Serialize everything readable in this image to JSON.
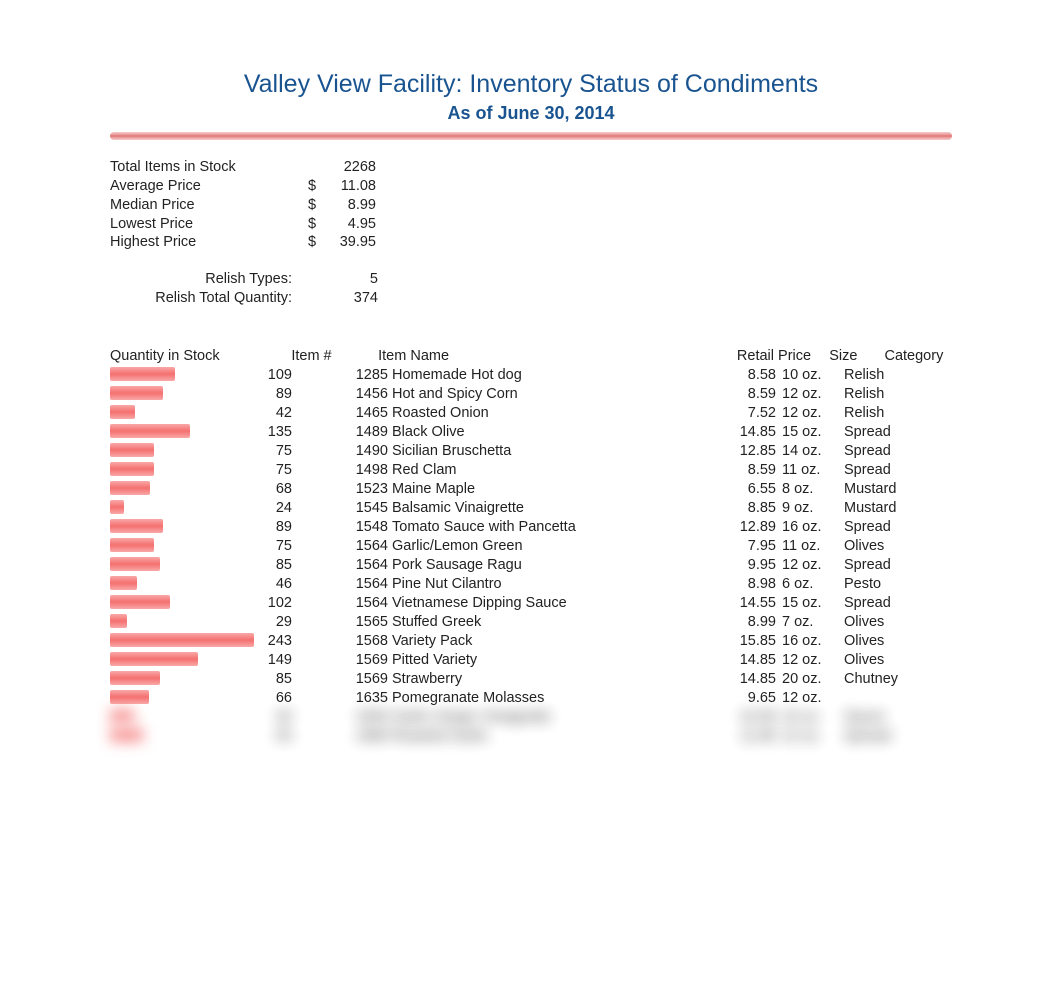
{
  "title": "Valley View Facility: Inventory Status of Condiments",
  "subtitle": "As of June 30, 2014",
  "stats": {
    "total_label": "Total Items in Stock",
    "total_value": "2268",
    "avg_label": "Average Price",
    "avg_dollar": "$",
    "avg_value": "11.08",
    "median_label": "Median Price",
    "median_dollar": "$",
    "median_value": "8.99",
    "lowest_label": "Lowest Price",
    "lowest_dollar": "$",
    "lowest_value": "4.95",
    "highest_label": "Highest Price",
    "highest_dollar": "$",
    "highest_value": "39.95"
  },
  "relish": {
    "types_label": "Relish Types:",
    "types_value": "5",
    "qty_label": "Relish Total Quantity:",
    "qty_value": "374"
  },
  "headers": {
    "qty": "Quantity in Stock",
    "item": "Item #",
    "name": "Item Name",
    "price": "Retail Price",
    "size": "Size",
    "category": "Category"
  },
  "rows": [
    {
      "qty": "109",
      "item": "1285",
      "name": "Homemade Hot dog",
      "price": "8.58",
      "size": "10 oz.",
      "cat": "Relish",
      "bar": 65
    },
    {
      "qty": "89",
      "item": "1456",
      "name": "Hot and Spicy Corn",
      "price": "8.59",
      "size": "12 oz.",
      "cat": "Relish",
      "bar": 53
    },
    {
      "qty": "42",
      "item": "1465",
      "name": "Roasted Onion",
      "price": "7.52",
      "size": "12 oz.",
      "cat": "Relish",
      "bar": 25
    },
    {
      "qty": "135",
      "item": "1489",
      "name": "Black Olive",
      "price": "14.85",
      "size": "15 oz.",
      "cat": "Spread",
      "bar": 80
    },
    {
      "qty": "75",
      "item": "1490",
      "name": "Sicilian Bruschetta",
      "price": "12.85",
      "size": "14 oz.",
      "cat": "Spread",
      "bar": 44
    },
    {
      "qty": "75",
      "item": "1498",
      "name": "Red Clam",
      "price": "8.59",
      "size": "11 oz.",
      "cat": "Spread",
      "bar": 44
    },
    {
      "qty": "68",
      "item": "1523",
      "name": "Maine Maple",
      "price": "6.55",
      "size": "8 oz.",
      "cat": "Mustard",
      "bar": 40
    },
    {
      "qty": "24",
      "item": "1545",
      "name": "Balsamic Vinaigrette",
      "price": "8.85",
      "size": "9 oz.",
      "cat": "Mustard",
      "bar": 14
    },
    {
      "qty": "89",
      "item": "1548",
      "name": "Tomato Sauce with Pancetta",
      "price": "12.89",
      "size": "16 oz.",
      "cat": "Spread",
      "bar": 53
    },
    {
      "qty": "75",
      "item": "1564",
      "name": "Garlic/Lemon Green",
      "price": "7.95",
      "size": "11 oz.",
      "cat": "Olives",
      "bar": 44
    },
    {
      "qty": "85",
      "item": "1564",
      "name": "Pork Sausage Ragu",
      "price": "9.95",
      "size": "12 oz.",
      "cat": "Spread",
      "bar": 50
    },
    {
      "qty": "46",
      "item": "1564",
      "name": "Pine Nut Cilantro",
      "price": "8.98",
      "size": "6 oz.",
      "cat": "Pesto",
      "bar": 27
    },
    {
      "qty": "102",
      "item": "1564",
      "name": "Vietnamese Dipping Sauce",
      "price": "14.55",
      "size": "15 oz.",
      "cat": "Spread",
      "bar": 60
    },
    {
      "qty": "29",
      "item": "1565",
      "name": "Stuffed Greek",
      "price": "8.99",
      "size": "7 oz.",
      "cat": "Olives",
      "bar": 17
    },
    {
      "qty": "243",
      "item": "1568",
      "name": "Variety Pack",
      "price": "15.85",
      "size": "16 oz.",
      "cat": "Olives",
      "bar": 144
    },
    {
      "qty": "149",
      "item": "1569",
      "name": "Pitted Variety",
      "price": "14.85",
      "size": "12 oz.",
      "cat": "Olives",
      "bar": 88
    },
    {
      "qty": "85",
      "item": "1569",
      "name": "Strawberry",
      "price": "14.85",
      "size": "20 oz.",
      "cat": "Chutney",
      "bar": 50
    },
    {
      "qty": "66",
      "item": "1635",
      "name": "Pomegranate Molasses",
      "price": "9.65",
      "size": "12 oz.",
      "cat": "",
      "bar": 39
    }
  ],
  "blurred_rows": [
    {
      "qty": "40",
      "item": "1650",
      "name": "Garlic Ginger Vinaigrette",
      "price": "10.95",
      "size": "10 oz.",
      "cat": "Sauce",
      "bar": 24
    },
    {
      "qty": "55",
      "item": "1680",
      "name": "Roasted Garlic",
      "price": "11.85",
      "size": "12 oz.",
      "cat": "Spread",
      "bar": 33
    }
  ]
}
